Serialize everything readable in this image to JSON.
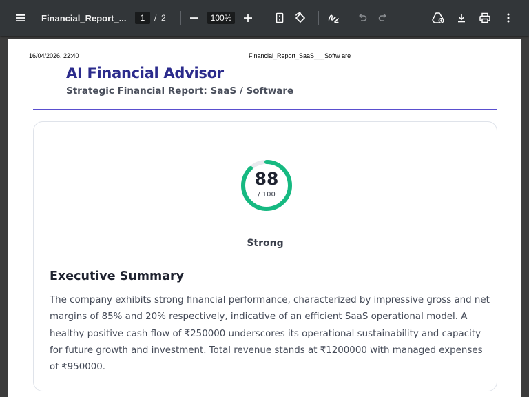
{
  "toolbar": {
    "file_title": "Financial_Report_...",
    "current_page": "1",
    "page_separator": "/",
    "total_pages": "2",
    "zoom": "100%",
    "icons": [
      "menu-icon",
      "zoom-out-icon",
      "zoom-in-icon",
      "fit-page-icon",
      "rotate-icon",
      "draw-icon",
      "undo-icon",
      "redo-icon",
      "drive-save-icon",
      "download-icon",
      "print-icon",
      "more-vert-icon"
    ]
  },
  "page": {
    "print_datetime": "16/04/2026, 22:40",
    "print_doc_title": "Financial_Report_SaaS___Softw are",
    "brand_title": "AI Financial Advisor",
    "subtitle": "Strategic Financial Report: SaaS / Software",
    "score": {
      "value": "88",
      "max_label": "/ 100",
      "fraction": 0.88,
      "rating": "Strong",
      "ring_color": "#16b981",
      "track_color": "#e8eaee"
    },
    "executive_summary": {
      "heading": "Executive Summary",
      "body": "The company exhibits strong financial performance, characterized by impressive gross and net margins of 85% and 20% respectively, indicative of an efficient SaaS operational model. A healthy positive cash flow of ₹250000 underscores its operational sustainability and capacity for future growth and investment. Total revenue stands at ₹1200000 with managed expenses of ₹950000."
    }
  },
  "colors": {
    "toolbar_bg": "#323639",
    "viewer_bg": "#3c3c3c",
    "brand": "#2b2b8c",
    "accent_rule": "#5a4fcf"
  }
}
